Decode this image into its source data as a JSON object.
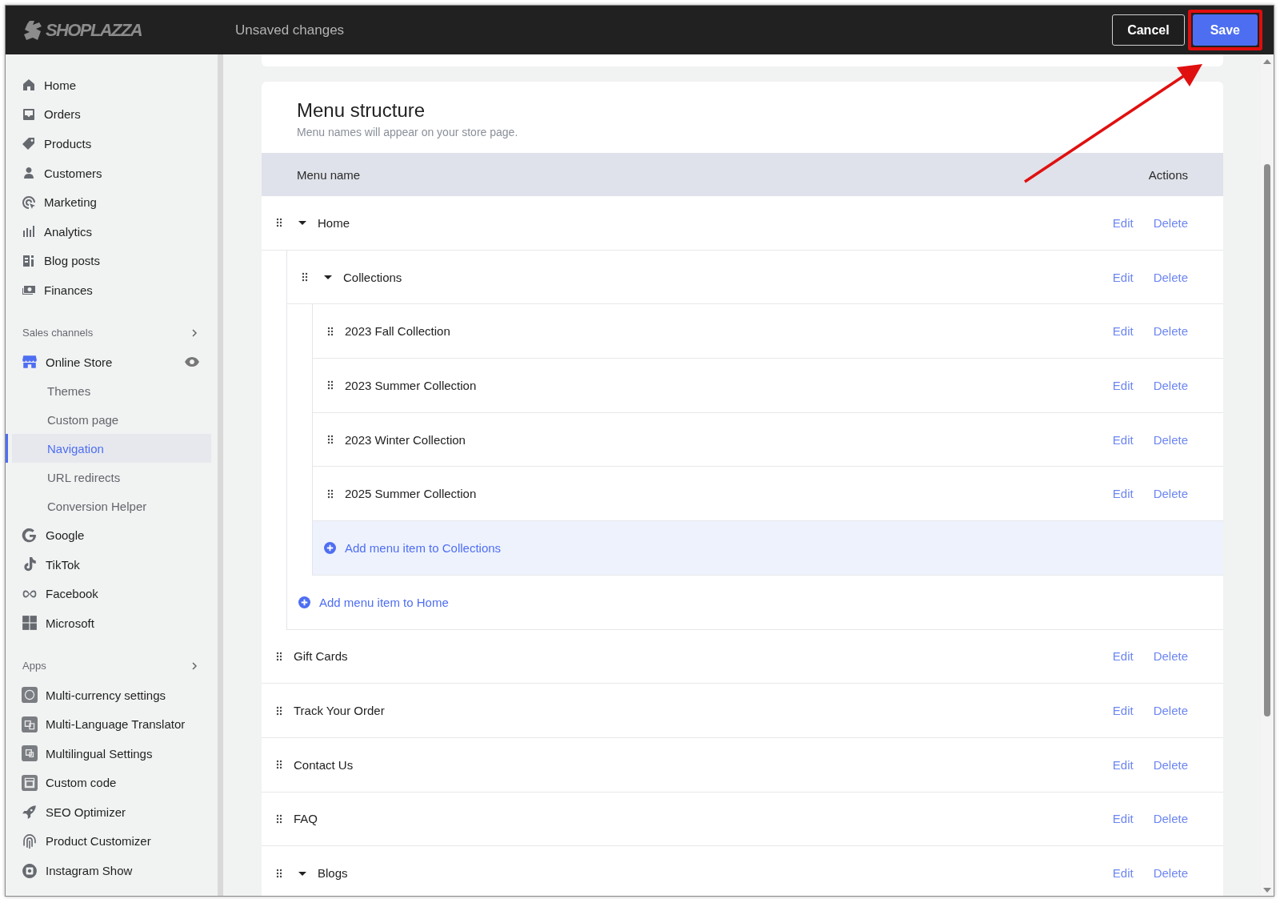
{
  "header": {
    "logo": "SHOPLAZZA",
    "status": "Unsaved changes",
    "buttons": [
      {
        "label": "Cancel",
        "kind": "secondary"
      },
      {
        "label": "Save",
        "kind": "primary"
      }
    ]
  },
  "sidebar": {
    "main": [
      {
        "label": "Home",
        "selected": false
      },
      {
        "label": "Orders",
        "selected": false
      },
      {
        "label": "Products",
        "selected": false
      },
      {
        "label": "Customers",
        "selected": false
      },
      {
        "label": "Marketing",
        "selected": false
      },
      {
        "label": "Analytics",
        "selected": false
      },
      {
        "label": "Blog posts",
        "selected": false
      },
      {
        "label": "Finances",
        "selected": false
      }
    ],
    "sections": [
      {
        "title": "Sales channels",
        "items": [
          {
            "label": "Online Store",
            "selected": false,
            "children": [
              {
                "label": "Themes",
                "selected": false
              },
              {
                "label": "Custom page",
                "selected": false
              },
              {
                "label": "Navigation",
                "selected": true
              },
              {
                "label": "URL redirects",
                "selected": false
              },
              {
                "label": "Conversion Helper",
                "selected": false
              }
            ]
          },
          {
            "label": "Google",
            "selected": false
          },
          {
            "label": "TikTok",
            "selected": false
          },
          {
            "label": "Facebook",
            "selected": false
          },
          {
            "label": "Microsoft",
            "selected": false
          }
        ]
      },
      {
        "title": "Apps",
        "items": [
          {
            "label": "Multi-currency settings",
            "selected": false
          },
          {
            "label": "Multi-Language Translator",
            "selected": false
          },
          {
            "label": "Multilingual Settings",
            "selected": false
          },
          {
            "label": "Custom code",
            "selected": false
          },
          {
            "label": "SEO Optimizer",
            "selected": false
          },
          {
            "label": "Product Customizer",
            "selected": false
          },
          {
            "label": "Instagram Show",
            "selected": false
          }
        ]
      }
    ]
  },
  "menu": {
    "title": "Menu structure",
    "subtitle": "Menu names will appear on your store page.",
    "columns": [
      "Menu name",
      "Actions"
    ],
    "items": [
      {
        "kind": "item",
        "name": "Home",
        "expanded": true,
        "actions": [
          "Edit",
          "Delete"
        ],
        "children": [
          {
            "kind": "item",
            "name": "Collections",
            "expanded": true,
            "actions": [
              "Edit",
              "Delete"
            ],
            "children": [
              {
                "kind": "item",
                "name": "2023 Fall Collection",
                "actions": [
                  "Edit",
                  "Delete"
                ]
              },
              {
                "kind": "item",
                "name": "2023 Summer Collection",
                "actions": [
                  "Edit",
                  "Delete"
                ]
              },
              {
                "kind": "item",
                "name": "2023 Winter Collection",
                "actions": [
                  "Edit",
                  "Delete"
                ]
              },
              {
                "kind": "item",
                "name": "2025 Summer Collection",
                "actions": [
                  "Edit",
                  "Delete"
                ]
              },
              {
                "kind": "add",
                "name": "Add menu item to Collections",
                "highlighted": true
              }
            ]
          },
          {
            "kind": "add",
            "name": "Add menu item to Home",
            "highlighted": false
          }
        ]
      },
      {
        "kind": "item",
        "name": "Gift Cards",
        "actions": [
          "Edit",
          "Delete"
        ]
      },
      {
        "kind": "item",
        "name": "Track Your Order",
        "actions": [
          "Edit",
          "Delete"
        ]
      },
      {
        "kind": "item",
        "name": "Contact Us",
        "actions": [
          "Edit",
          "Delete"
        ]
      },
      {
        "kind": "item",
        "name": "FAQ",
        "actions": [
          "Edit",
          "Delete"
        ]
      },
      {
        "kind": "item",
        "name": "Blogs",
        "expanded": true,
        "actions": [
          "Edit",
          "Delete"
        ]
      }
    ]
  }
}
